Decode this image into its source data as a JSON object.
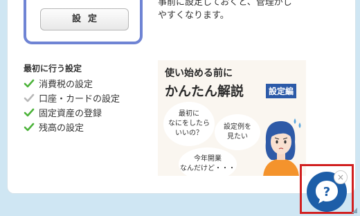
{
  "top_card": {
    "button_label": "設定"
  },
  "description": {
    "line1": "事前に設定しておくと、管理がし",
    "line2": "やすくなります。"
  },
  "first_setup": {
    "title": "最初に行う設定",
    "items": [
      {
        "label": "消費税の設定",
        "check_color": "#4cb33a"
      },
      {
        "label": "口座・カードの設定",
        "check_color": "#b8b8b8"
      },
      {
        "label": "固定資産の登録",
        "check_color": "#4cb33a"
      },
      {
        "label": "残高の設定",
        "check_color": "#4cb33a"
      }
    ]
  },
  "banner": {
    "title_line1": "使い始める前に",
    "title_line2": "かんたん解説",
    "badge": "設定編",
    "bubble1_line1": "最初に",
    "bubble1_line2": "なにをしたら",
    "bubble1_line3": "いいの？",
    "bubble2_line1": "設定例を",
    "bubble2_line2": "見たい",
    "bubble3_line1": "今年開業",
    "bubble3_line2": "なんだけど・・・"
  },
  "help_widget": {
    "icon": "question-icon",
    "close_label": "×",
    "color": "#1d5ea8"
  }
}
